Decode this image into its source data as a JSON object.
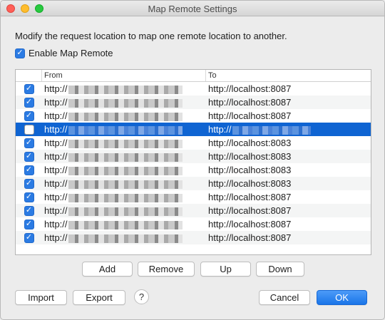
{
  "window": {
    "title": "Map Remote Settings"
  },
  "description": "Modify the request location to map one remote location to another.",
  "enable": {
    "label": "Enable Map Remote",
    "checked": true
  },
  "table": {
    "headers": {
      "from": "From",
      "to": "To"
    },
    "rows": [
      {
        "checked": true,
        "from": "http://",
        "to": "http://localhost:8087",
        "selected": false
      },
      {
        "checked": true,
        "from": "http://",
        "to": "http://localhost:8087",
        "selected": false
      },
      {
        "checked": true,
        "from": "http://",
        "to": "http://localhost:8087",
        "selected": false
      },
      {
        "checked": false,
        "from": "http://",
        "to": "http://",
        "selected": true
      },
      {
        "checked": true,
        "from": "http://",
        "to": "http://localhost:8083",
        "selected": false
      },
      {
        "checked": true,
        "from": "http://",
        "to": "http://localhost:8083",
        "selected": false
      },
      {
        "checked": true,
        "from": "http://",
        "to": "http://localhost:8083",
        "selected": false
      },
      {
        "checked": true,
        "from": "http://",
        "to": "http://localhost:8083",
        "selected": false
      },
      {
        "checked": true,
        "from": "http://",
        "to": "http://localhost:8087",
        "selected": false
      },
      {
        "checked": true,
        "from": "http://",
        "to": "http://localhost:8087",
        "selected": false
      },
      {
        "checked": true,
        "from": "http://",
        "to": "http://localhost:8087",
        "selected": false
      },
      {
        "checked": true,
        "from": "http://",
        "to": "http://localhost:8087",
        "selected": false
      }
    ]
  },
  "buttons": {
    "add": "Add",
    "remove": "Remove",
    "up": "Up",
    "down": "Down",
    "import": "Import",
    "export": "Export",
    "help": "?",
    "cancel": "Cancel",
    "ok": "OK"
  },
  "icons": {
    "check": "checkmark-icon"
  },
  "colors": {
    "accent": "#0f64d2",
    "ok_button": "#1a75e8"
  }
}
